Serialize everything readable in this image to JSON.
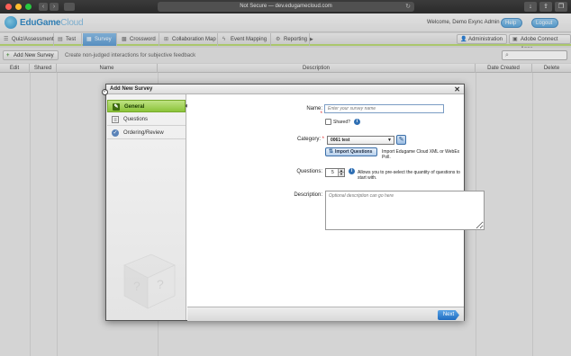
{
  "browser": {
    "url": "Not Secure — dev.edugamecloud.com"
  },
  "header": {
    "logo_text_main": "EduGame",
    "logo_text_sub": "Cloud",
    "welcome": "Welcome, Demo Exync Admin",
    "help_label": "Help",
    "logout_label": "Logout"
  },
  "nav": {
    "tabs": [
      {
        "label": "Quiz/Assessment",
        "icon": "quiz-icon"
      },
      {
        "label": "Test",
        "icon": "test-icon"
      },
      {
        "label": "Survey",
        "icon": "survey-icon",
        "active": true
      },
      {
        "label": "Crossword",
        "icon": "crossword-icon"
      },
      {
        "label": "Collaboration Map",
        "icon": "map-icon"
      },
      {
        "label": "Event Mapping",
        "icon": "lightning-icon"
      },
      {
        "label": "Reporting",
        "icon": "reporting-icon"
      }
    ],
    "admin_label": "Administration",
    "adobe_label": "Adobe Connect Apps"
  },
  "toolbar": {
    "add_label": "Add New Survey",
    "hint": "Create non-judged interactions for subjective feedback"
  },
  "table": {
    "columns": [
      "Edit",
      "Shared",
      "Name",
      "Description",
      "Date Created",
      "Delete"
    ]
  },
  "dialog": {
    "title": "Add New Survey",
    "steps": [
      {
        "label": "General",
        "active": true
      },
      {
        "label": "Questions",
        "active": false
      },
      {
        "label": "Ordering/Review",
        "active": false
      }
    ],
    "name_label": "Name:",
    "name_placeholder": "Enter your survey name",
    "shared_label": "Shared?",
    "category_label": "Category:",
    "category_value": "0061 test",
    "import_button": "Import Questions",
    "import_text": "Import Edugame Cloud XML or WebEx Poll.",
    "questions_label": "Questions:",
    "questions_value": "5",
    "questions_hint": "Allows you to pre-select the quantity of questions to start with.",
    "description_label": "Description:",
    "description_placeholder": "Optional description can go here",
    "next_label": "Next"
  },
  "colors": {
    "accent_blue": "#4f93cf",
    "active_green": "#8cc43a"
  }
}
